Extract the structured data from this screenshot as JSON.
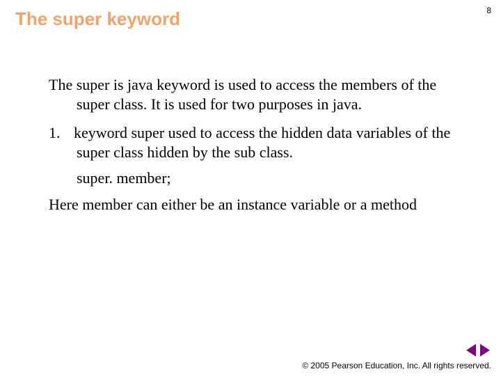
{
  "header": {
    "title": "The super keyword",
    "page_number": "8"
  },
  "content": {
    "intro": "The super is java keyword is used to access the members of the super class. It is used for two purposes in java.",
    "item1_num": "1.",
    "item1_text": "keyword super used to access the hidden data variables of the super class hidden by the sub class.",
    "item1_sub": "super. member;",
    "closing": "Here member can either be an instance variable or a method"
  },
  "footer": {
    "copyright": "© 2005 Pearson Education, Inc.  All rights reserved."
  }
}
